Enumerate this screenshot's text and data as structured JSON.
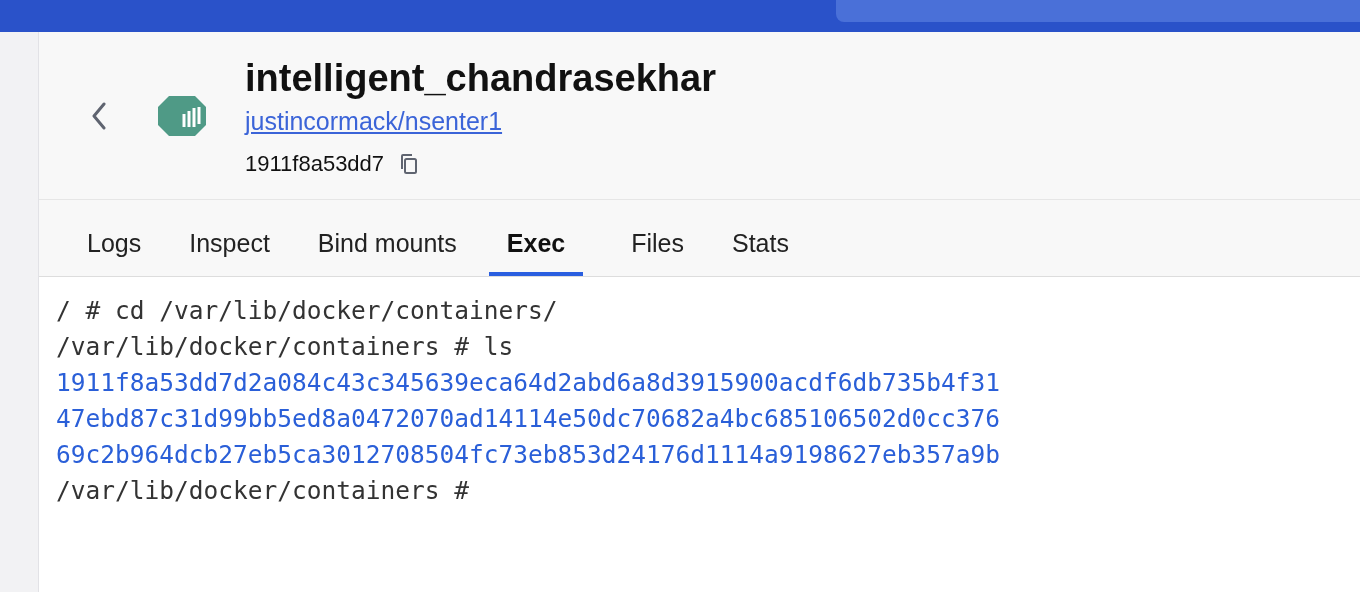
{
  "container": {
    "name": "intelligent_chandrasekhar",
    "image": "justincormack/nsenter1",
    "id": "1911f8a53dd7"
  },
  "tabs": [
    {
      "label": "Logs",
      "selected": false
    },
    {
      "label": "Inspect",
      "selected": false
    },
    {
      "label": "Bind mounts",
      "selected": false
    },
    {
      "label": "Exec",
      "selected": true
    },
    {
      "label": "Files",
      "selected": false
    },
    {
      "label": "Stats",
      "selected": false
    }
  ],
  "terminal": {
    "lines": [
      {
        "kind": "command",
        "text": "/ # cd /var/lib/docker/containers/"
      },
      {
        "kind": "command",
        "text": "/var/lib/docker/containers # ls"
      },
      {
        "kind": "directory",
        "text": "1911f8a53dd7d2a084c43c345639eca64d2abd6a8d3915900acdf6db735b4f31"
      },
      {
        "kind": "directory",
        "text": "47ebd87c31d99bb5ed8a0472070ad14114e50dc70682a4bc685106502d0cc376"
      },
      {
        "kind": "directory",
        "text": "69c2b964dcb27eb5ca3012708504fc73eb853d24176d1114a9198627eb357a9b"
      },
      {
        "kind": "command",
        "text": "/var/lib/docker/containers #"
      }
    ]
  }
}
